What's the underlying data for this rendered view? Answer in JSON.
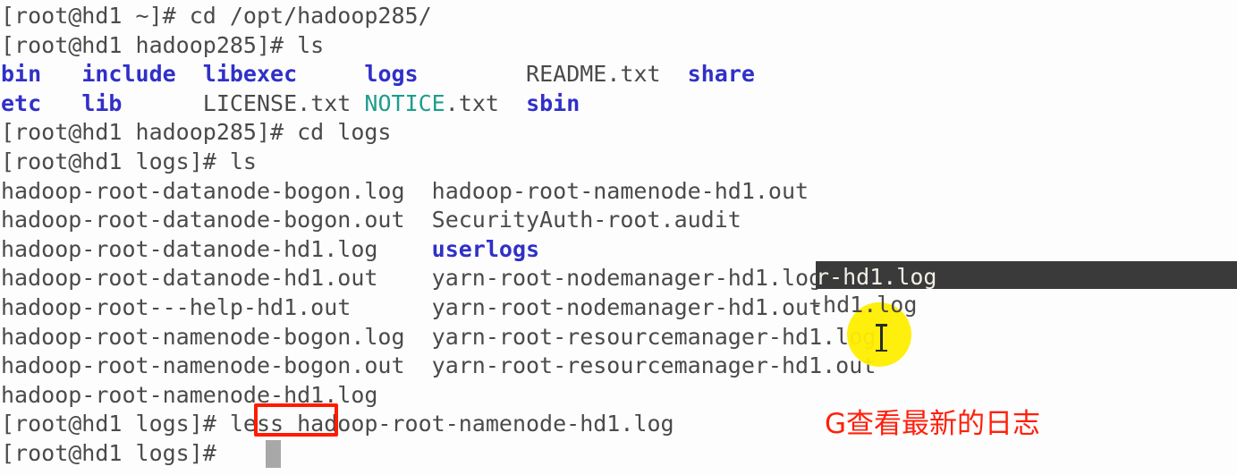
{
  "terminal": {
    "background_color": "#fdfdfd",
    "foreground_color": "#4a4a4a",
    "dir_color": "#3030c8",
    "archive_color": "#1d9e8e",
    "selection_background": "#3a3a3a",
    "selection_foreground": "#f3efe7",
    "annotation_color": "#ff1f0a",
    "cursor_color": "#a8a8a8",
    "lines": [
      {
        "id": "prompt-cd-hadoop",
        "text": "[root@hd1 ~]# cd /opt/hadoop285/"
      },
      {
        "id": "prompt-ls-hadoop",
        "text": "[root@hd1 hadoop285]# ls"
      },
      {
        "id": "ls-row-1",
        "text": "bin   include  libexec     logs        README.txt  share"
      },
      {
        "id": "ls-row-2",
        "text": "etc   lib      LICENSE.txt NOTICE.txt  sbin"
      },
      {
        "id": "prompt-cd-logs",
        "text": "[root@hd1 hadoop285]# cd logs"
      },
      {
        "id": "prompt-ls-logs",
        "text": "[root@hd1 logs]# ls"
      },
      {
        "id": "logs-row-1",
        "text": "hadoop-root-datanode-bogon.log  hadoop-root-namenode-hd1.out"
      },
      {
        "id": "logs-row-2",
        "text": "hadoop-root-datanode-bogon.out  SecurityAuth-root.audit"
      },
      {
        "id": "logs-row-3",
        "text": "hadoop-root-datanode-hd1.log    userlogs"
      },
      {
        "id": "logs-row-4",
        "text": "hadoop-root-datanode-hd1.out    yarn-root-nodemanager-hd1.log"
      },
      {
        "id": "logs-row-5",
        "text": "hadoop-root---help-hd1.out      yarn-root-nodemanager-hd1.out"
      },
      {
        "id": "logs-row-6",
        "text": "hadoop-root-namenode-bogon.log  yarn-root-resourcemanager-hd1.log"
      },
      {
        "id": "logs-row-7",
        "text": "hadoop-root-namenode-bogon.out  yarn-root-resourcemanager-hd1.out"
      },
      {
        "id": "logs-row-8",
        "text": "hadoop-root-namenode-hd1.log"
      },
      {
        "id": "prompt-less",
        "text": "[root@hd1 logs]# less hadoop-root-namenode-hd1.log"
      },
      {
        "id": "prompt-final",
        "text": "[root@hd1 logs]# "
      }
    ],
    "ls_row_1": {
      "bin": "bin",
      "include": "include",
      "libexec": "libexec",
      "logs": "logs",
      "readme": "README.txt",
      "share": "share"
    },
    "ls_row_2": {
      "etc": "etc",
      "lib": "lib",
      "license": "LICENSE.txt",
      "notice_name": "NOTICE",
      "notice_ext": ".txt",
      "sbin": "sbin"
    },
    "logs_rows": [
      {
        "left": "hadoop-root-datanode-bogon.log",
        "right": "hadoop-root-namenode-hd1.out"
      },
      {
        "left": "hadoop-root-datanode-bogon.out",
        "right": "SecurityAuth-root.audit"
      },
      {
        "left": "hadoop-root-datanode-hd1.log",
        "right": "userlogs"
      },
      {
        "left": "hadoop-root-datanode-hd1.out",
        "right": "yarn-root-nodemanager-hd1.log"
      },
      {
        "left": "hadoop-root---help-hd1.out",
        "right": "yarn-root-nodemanager-hd1.out"
      },
      {
        "left": "hadoop-root-namenode-bogon.log",
        "right": "yarn-root-resourcemanager-hd1.log"
      },
      {
        "left": "hadoop-root-namenode-bogon.out",
        "right": "yarn-root-resourcemanager-hd1.out"
      },
      {
        "left": "hadoop-root-namenode-hd1.log",
        "right": ""
      }
    ],
    "selection": {
      "unselected_prefix": "yarn-root-nodemanage",
      "selected_text": "r-hd1.log"
    },
    "highlighted_row": {
      "left": "hadoop-root-namenode-bogon.log",
      "right_before": "yarn-root-resourcemanag",
      "right_after": "-hd1.log"
    },
    "less_command": {
      "prompt": "[root@hd1 logs]# ",
      "command": "less",
      "argument": " hadoop-root-namenode-hd1.log"
    },
    "final_prompt": "[root@hd1 logs]# ",
    "annotation": "G查看最新的日志"
  }
}
